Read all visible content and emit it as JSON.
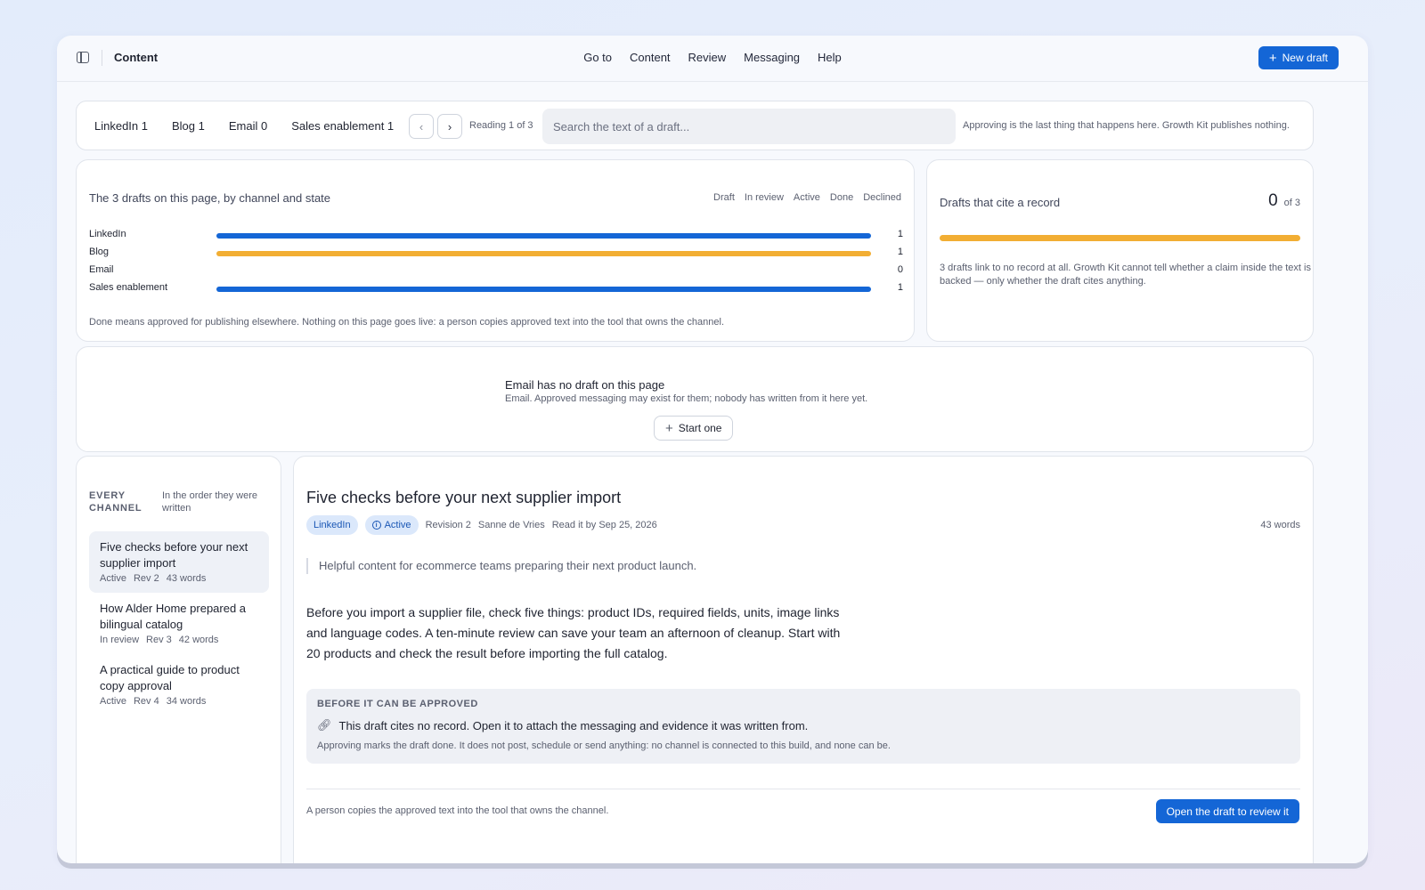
{
  "topbar": {
    "title": "Content",
    "nav": [
      "Go to",
      "Content",
      "Review",
      "Messaging",
      "Help"
    ],
    "new_draft": "New draft"
  },
  "filterbar": {
    "tabs": [
      "LinkedIn 1",
      "Blog 1",
      "Email 0",
      "Sales enablement 1"
    ],
    "reading": "Reading 1 of 3",
    "search_placeholder": "Search the text of a draft...",
    "note": "Approving is the last thing that happens here. Growth Kit publishes nothing."
  },
  "chart": {
    "title": "The 3 drafts on this page, by channel and state",
    "legend": [
      "Draft",
      "In review",
      "Active",
      "Done",
      "Declined"
    ],
    "footnote": "Done means approved for publishing elsewhere. Nothing on this page goes live: a person copies approved text into the tool that owns the channel."
  },
  "chart_data": {
    "type": "bar",
    "categories": [
      "LinkedIn",
      "Blog",
      "Email",
      "Sales enablement"
    ],
    "values": [
      1,
      1,
      0,
      1
    ],
    "colors": [
      "#1466d6",
      "#f2ae33",
      "#1466d6",
      "#1466d6"
    ],
    "max": 1
  },
  "cite": {
    "title": "Drafts that cite a record",
    "count": "0",
    "of": "of 3",
    "fraction_uncited": 1,
    "bar_color": "#f2ae33",
    "note": "3 drafts link to no record at all. Growth Kit cannot tell whether a claim inside the text is backed — only whether the draft cites anything."
  },
  "empty": {
    "title": "Email has no draft on this page",
    "sub": "Email. Approved messaging may exist for them; nobody has written from it here yet.",
    "button": "Start one"
  },
  "list": {
    "heading": "EVERY CHANNEL",
    "sub": "In the order they were written",
    "items": [
      {
        "title": "Five checks before your next supplier import",
        "state": "Active",
        "rev": "Rev 2",
        "words": "43 words"
      },
      {
        "title": "How Alder Home prepared a bilingual catalog",
        "state": "In review",
        "rev": "Rev 3",
        "words": "42 words"
      },
      {
        "title": "A practical guide to product copy approval",
        "state": "Active",
        "rev": "Rev 4",
        "words": "34 words"
      }
    ]
  },
  "detail": {
    "title": "Five checks before your next supplier import",
    "channel": "LinkedIn",
    "state": "Active",
    "revision": "Revision 2",
    "author": "Sanne de Vries",
    "read_by": "Read it by Sep 25, 2026",
    "words": "43 words",
    "quote": "Helpful content for ecommerce teams preparing their next product launch.",
    "body": "Before you import a supplier file, check five things: product IDs, required fields, units, image links and language codes. A ten-minute review can save your team an afternoon of cleanup. Start with 20 products and check the result before importing the full catalog.",
    "gate_heading": "BEFORE IT CAN BE APPROVED",
    "gate_reason": "This draft cites no record. Open it to attach the messaging and evidence it was written from.",
    "gate_note": "Approving marks the draft done. It does not post, schedule or send anything: no channel is connected to this build, and none can be.",
    "footer_note": "A person copies the approved text into the tool that owns the channel.",
    "review_button": "Open the draft to review it"
  }
}
